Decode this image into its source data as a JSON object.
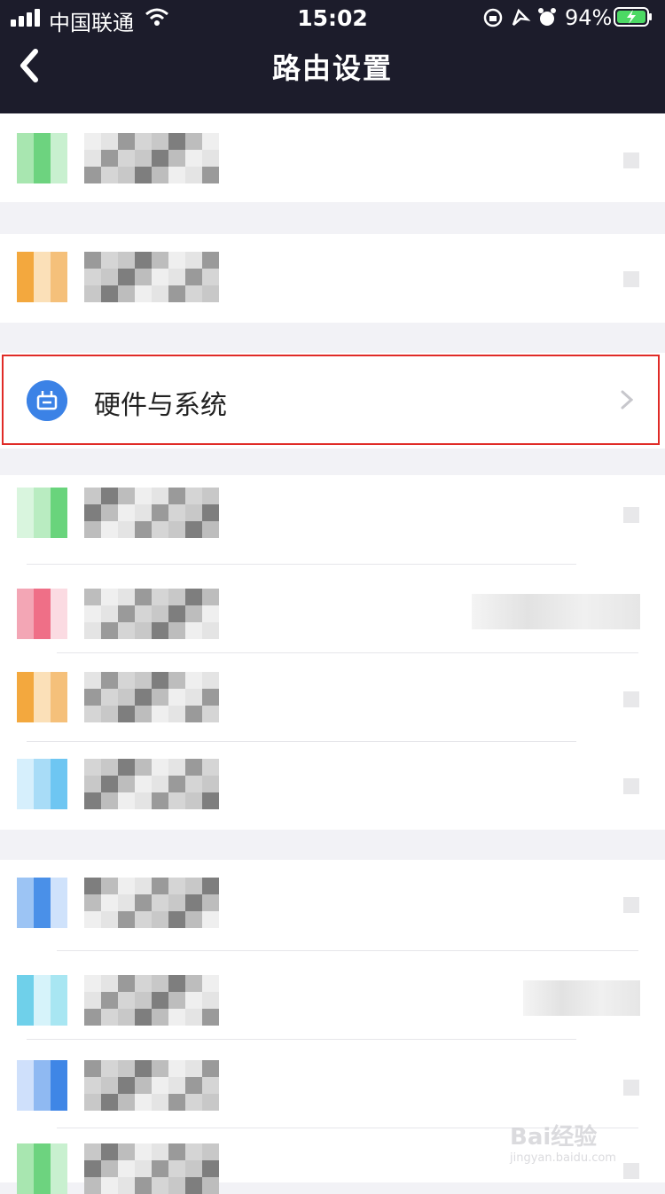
{
  "status_bar": {
    "carrier": "中国联通",
    "time": "15:02",
    "battery_percent": "94%",
    "icons": [
      "signal-icon",
      "wifi-icon",
      "orientation-lock-icon",
      "location-icon",
      "alarm-icon",
      "battery-charging-icon"
    ]
  },
  "nav": {
    "title": "路由设置",
    "back_icon": "chevron-left-icon"
  },
  "highlighted_item": {
    "label": "硬件与系统",
    "icon": "router-icon",
    "icon_color": "#3b82e6",
    "highlight_color": "#e02b27"
  },
  "watermark": {
    "text": "Bai经验",
    "sub": "jingyan.baidu.com"
  },
  "colors": {
    "header_bg": "#1c1c2b",
    "page_bg": "#f2f2f6"
  }
}
